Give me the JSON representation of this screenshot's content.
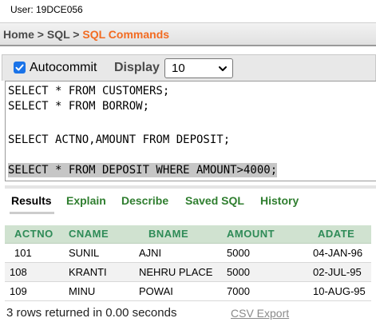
{
  "user_label": "User: 19DCE056",
  "breadcrumb": {
    "home": "Home",
    "sep1": " > ",
    "sql": "SQL",
    "sep2": " > ",
    "current": "SQL Commands"
  },
  "toolbar": {
    "autocommit_label": "Autocommit",
    "autocommit_checked": true,
    "display_label": "Display",
    "display_value": "10"
  },
  "editor": {
    "lines": [
      "SELECT * FROM CUSTOMERS;",
      "SELECT * FROM BORROW;",
      "",
      "SELECT ACTNO,AMOUNT FROM DEPOSIT;",
      "",
      "SELECT * FROM DEPOSIT WHERE AMOUNT>4000;"
    ],
    "selected_line_index": 5
  },
  "tabs": [
    {
      "label": "Results",
      "active": true
    },
    {
      "label": "Explain",
      "active": false
    },
    {
      "label": "Describe",
      "active": false
    },
    {
      "label": "Saved SQL",
      "active": false
    },
    {
      "label": "History",
      "active": false
    }
  ],
  "results": {
    "columns": [
      "ACTNO",
      "CNAME",
      "BNAME",
      "AMOUNT",
      "ADATE"
    ],
    "rows": [
      [
        "101",
        "SUNIL",
        "AJNI",
        "5000",
        "04-JAN-96"
      ],
      [
        "108",
        "KRANTI",
        "NEHRU PLACE",
        "5000",
        "02-JUL-95"
      ],
      [
        "109",
        "MINU",
        "POWAI",
        "7000",
        "10-AUG-95"
      ]
    ]
  },
  "status": "3 rows returned in 0.00 seconds",
  "csv_export": "CSV Export",
  "colors": {
    "accent_orange": "#f26b21",
    "tab_green": "#2f7e2f",
    "header_green": "#2e8b57",
    "header_bg": "#d0e2d0",
    "checkbox_blue": "#1a73e8"
  }
}
